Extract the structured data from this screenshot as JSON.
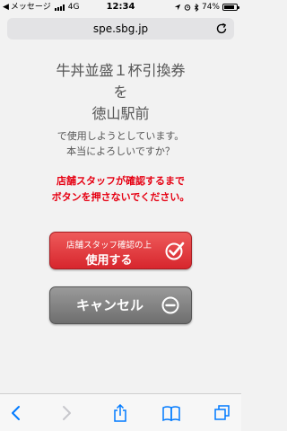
{
  "status_bar": {
    "back_app": "メッセージ",
    "network": "4G",
    "time": "12:34",
    "battery": "74%"
  },
  "address_bar": {
    "url": "spe.sbg.jp"
  },
  "coupon": {
    "line1": "牛丼並盛１杯引換券",
    "line2": "を",
    "line3": "徳山駅前"
  },
  "confirm": {
    "line1": "で使用しようとしています。",
    "line2": "本当によろしいですか？"
  },
  "warning": {
    "line1": "店舗スタッフが確認するまで",
    "line2": "ボタンを押さないでください。"
  },
  "buttons": {
    "use_line1": "店舗スタッフ確認の上",
    "use_line2": "使用する",
    "cancel": "キャンセル"
  },
  "colors": {
    "accent_red": "#e60012",
    "ios_blue": "#007aff"
  },
  "icons": {
    "use": "check-circle-icon",
    "cancel": "minus-circle-icon",
    "reload": "reload-icon",
    "toolbar": [
      "back-icon",
      "forward-icon",
      "share-icon",
      "bookmarks-icon",
      "tabs-icon"
    ]
  }
}
